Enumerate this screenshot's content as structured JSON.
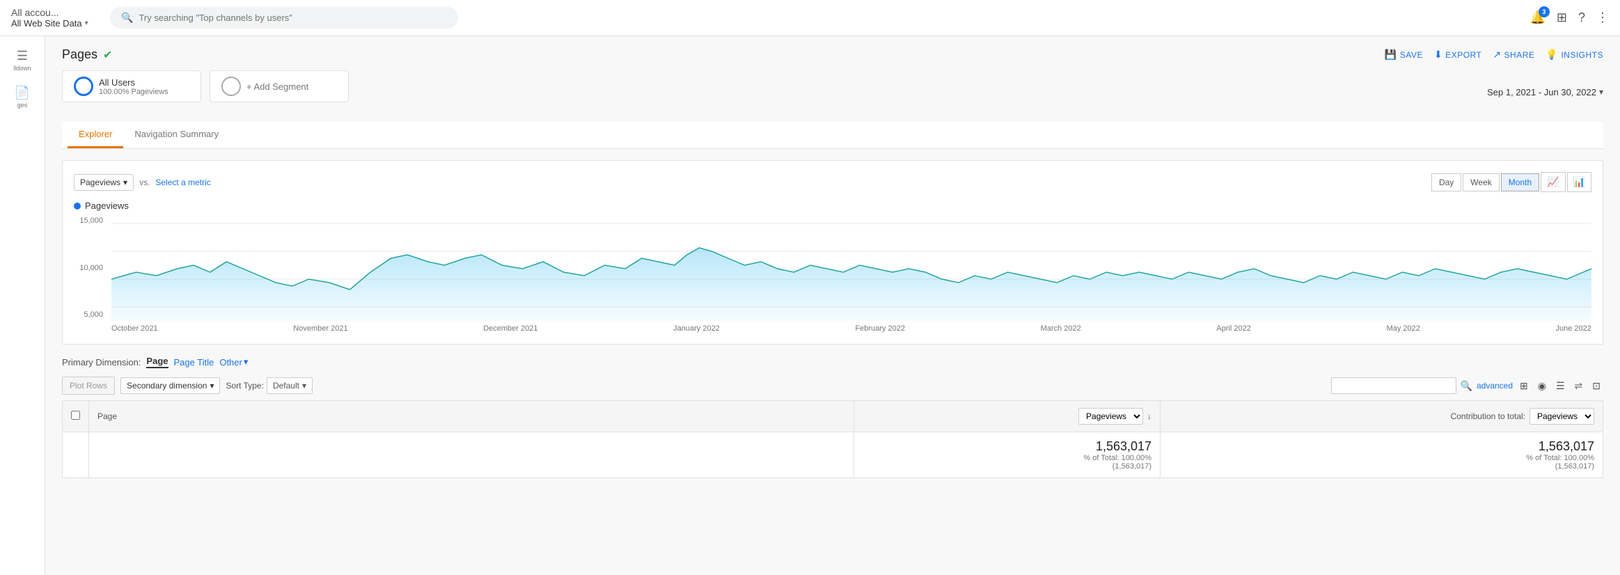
{
  "header": {
    "account_name": "All accou...",
    "property_name": "All Web Site Data",
    "search_placeholder": "Try searching \"Top channels by users\"",
    "notification_count": "3"
  },
  "page": {
    "title": "Pages",
    "date_range": "Sep 1, 2021 - Jun 30, 2022",
    "actions": {
      "save": "SAVE",
      "export": "EXPORT",
      "share": "SHARE",
      "insights": "INSIGHTS"
    }
  },
  "segments": {
    "active": {
      "name": "All Users",
      "sub": "100.00% Pageviews"
    },
    "add": "+ Add Segment"
  },
  "tabs": [
    "Explorer",
    "Navigation Summary"
  ],
  "chart": {
    "metric": "Pageviews",
    "vs_label": "vs.",
    "select_metric": "Select a metric",
    "time_buttons": [
      "Day",
      "Week",
      "Month"
    ],
    "active_time": "Month",
    "y_labels": [
      "15,000",
      "10,000",
      "5,000"
    ],
    "x_labels": [
      "October 2021",
      "November 2021",
      "December 2021",
      "January 2022",
      "February 2022",
      "March 2022",
      "April 2022",
      "May 2022",
      "June 2022"
    ],
    "legend": "Pageviews"
  },
  "primary_dimension": {
    "label": "Primary Dimension:",
    "options": [
      "Page",
      "Page Title",
      "Other"
    ]
  },
  "table_controls": {
    "plot_rows": "Plot Rows",
    "secondary_dim": "Secondary dimension",
    "sort_type": "Sort Type:",
    "sort_default": "Default",
    "advanced": "advanced"
  },
  "table": {
    "col_page": "Page",
    "col_pageviews": "Pageviews",
    "col_contribution": "Contribution to total:",
    "col_contribution_metric": "Pageviews",
    "total_value": "1,563,017",
    "total_sub1": "% of Total: 100.00%",
    "total_sub2": "(1,563,017)",
    "contribution_value": "1,563,017",
    "contribution_sub1": "% of Total: 100.00%",
    "contribution_sub2": "(1,563,017)"
  },
  "sidebar": {
    "items": [
      {
        "icon": "▼",
        "label": "lldown"
      },
      {
        "icon": "◻",
        "label": "ges"
      }
    ]
  }
}
